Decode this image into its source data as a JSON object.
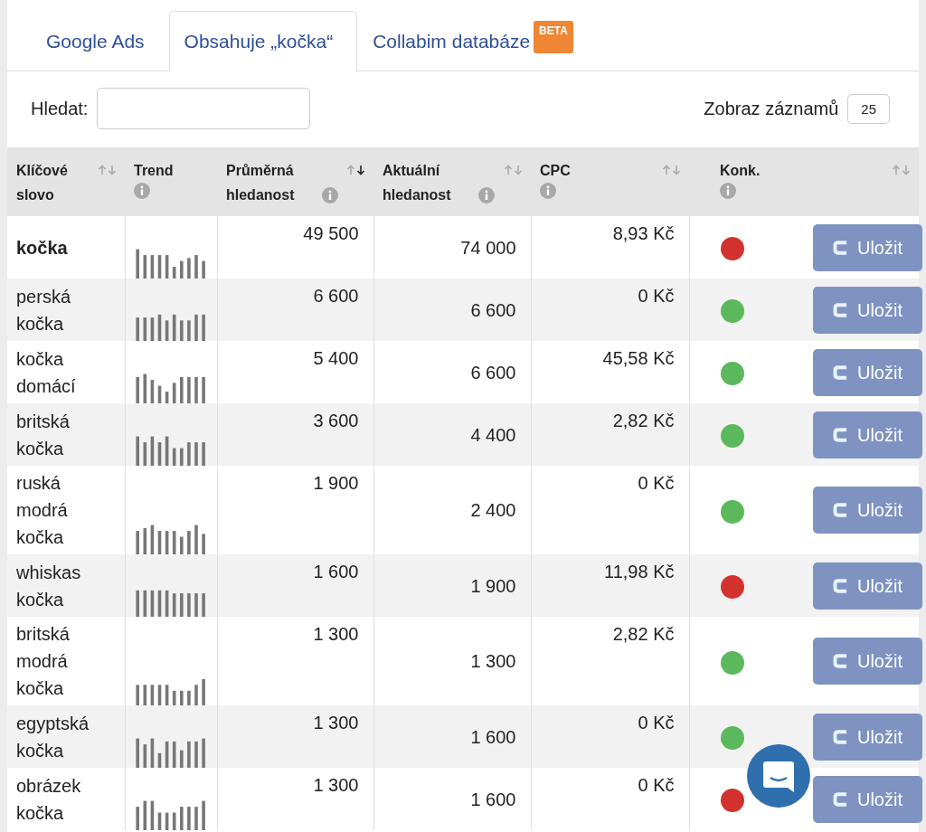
{
  "tabs": [
    {
      "label": "Google Ads",
      "selected": false
    },
    {
      "label": "Obsahuje „kočka“",
      "selected": true
    },
    {
      "label": "Collabim databáze",
      "selected": false,
      "badge": "BETA"
    }
  ],
  "search": {
    "label": "Hledat:"
  },
  "page_size": {
    "label": "Zobraz záznamů",
    "value": "25"
  },
  "table": {
    "columns": [
      {
        "label": "Klíčové slovo",
        "sortable": true,
        "sorted_desc": false,
        "info": false
      },
      {
        "label": "Trend",
        "sortable": false,
        "info": true
      },
      {
        "label": "Průměrná hledanost",
        "sortable": true,
        "sorted_desc": true,
        "info": true
      },
      {
        "label": "Aktuální hledanost",
        "sortable": true,
        "sorted_desc": false,
        "info": true
      },
      {
        "label": "CPC",
        "sortable": true,
        "sorted_desc": false,
        "info": true
      },
      {
        "label": "Konk.",
        "sortable": true,
        "sorted_desc": false,
        "info": true
      }
    ],
    "rows": [
      {
        "keyword": "kočka",
        "bold": true,
        "average": "49 500",
        "current": "74 000",
        "cpc": "8,93 Kč",
        "color": "#d2322d",
        "action": "Uložit"
      },
      {
        "keyword": "perská kočka",
        "bold": false,
        "average": "6 600",
        "current": "6 600",
        "cpc": "0 Kč",
        "color": "#5cb85c",
        "action": "Uložit"
      },
      {
        "keyword": "kočka domácí",
        "bold": false,
        "average": "5 400",
        "current": "6 600",
        "cpc": "45,58 Kč",
        "color": "#5cb85c",
        "action": "Uložit"
      },
      {
        "keyword": "britská kočka",
        "bold": false,
        "average": "3 600",
        "current": "4 400",
        "cpc": "2,82 Kč",
        "color": "#5cb85c",
        "action": "Uložit"
      },
      {
        "keyword": "ruská modrá kočka",
        "bold": false,
        "average": "1 900",
        "current": "2 400",
        "cpc": "0 Kč",
        "color": "#5cb85c",
        "action": "Uložit"
      },
      {
        "keyword": "whiskas kočka",
        "bold": false,
        "average": "1 600",
        "current": "1 900",
        "cpc": "11,98 Kč",
        "color": "#d2322d",
        "action": "Uložit"
      },
      {
        "keyword": "britská modrá kočka",
        "bold": false,
        "average": "1 300",
        "current": "1 300",
        "cpc": "2,82 Kč",
        "color": "#5cb85c",
        "action": "Uložit"
      },
      {
        "keyword": "egyptská kočka",
        "bold": false,
        "average": "1 300",
        "current": "1 600",
        "cpc": "0 Kč",
        "color": "#5cb85c",
        "action": "Uložit"
      },
      {
        "keyword": "obrázek kočka",
        "bold": false,
        "average": "1 300",
        "current": "1 600",
        "cpc": "0 Kč",
        "color": "#d2322d",
        "action": "Uložit"
      }
    ]
  }
}
